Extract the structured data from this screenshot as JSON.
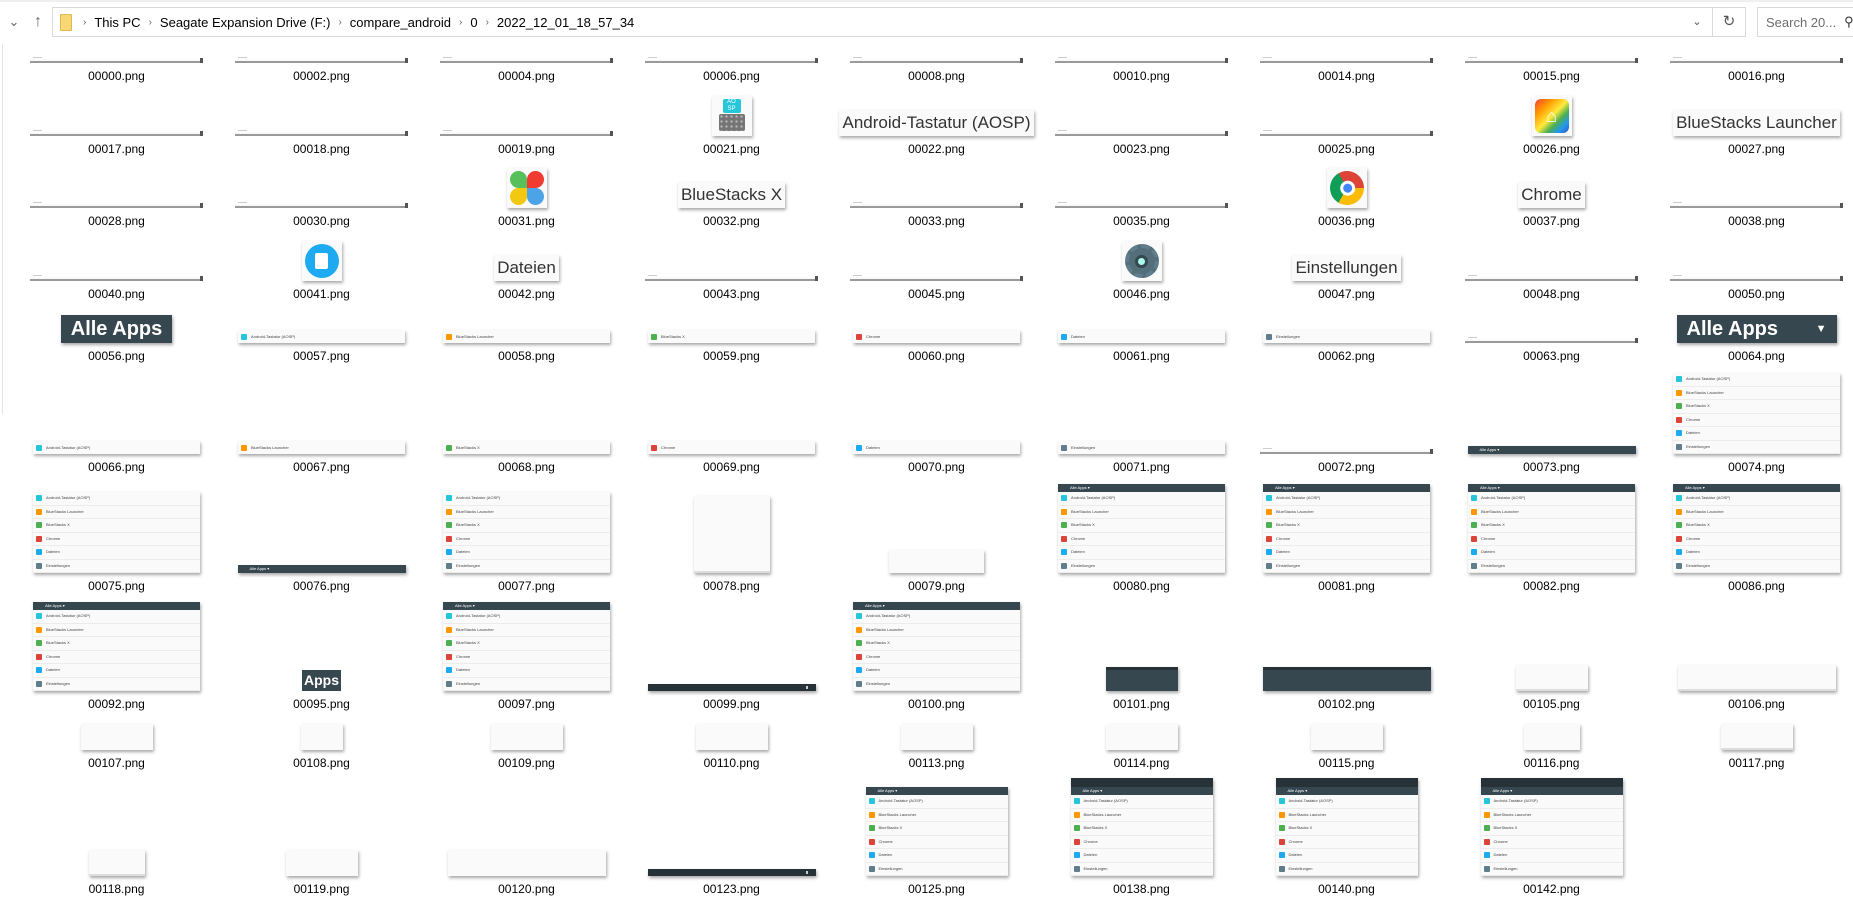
{
  "address_bar": {
    "breadcrumbs": [
      "This PC",
      "Seagate Expansion Drive (F:)",
      "compare_android",
      "0",
      "2022_12_01_18_57_34"
    ],
    "search_placeholder": "Search 20..."
  },
  "icons": {
    "up": "up-arrow-icon",
    "recent": "chevron-down-icon",
    "refresh": "refresh-icon",
    "search": "search-icon",
    "folder": "folder-icon"
  },
  "colors": {
    "header_dark": "#37474f",
    "toolbar_dark": "#263238"
  },
  "app_list": [
    {
      "name": "Android-Tastatur (AOSP)",
      "color": "#26c6da"
    },
    {
      "name": "BlueStacks Launcher",
      "color": "#ff9800"
    },
    {
      "name": "BlueStacks X",
      "color": "#4caf50"
    },
    {
      "name": "Chrome",
      "color": "#db4437"
    },
    {
      "name": "Dateien",
      "color": "#1eaaf1"
    },
    {
      "name": "Einstellungen",
      "color": "#607d8b"
    }
  ],
  "list_header_label": "Alle Apps ▾",
  "rows": [
    [
      {
        "name": "00000.png",
        "t": "bar"
      },
      {
        "name": "00002.png",
        "t": "bar"
      },
      {
        "name": "00004.png",
        "t": "bar"
      },
      {
        "name": "00006.png",
        "t": "bar"
      },
      {
        "name": "00008.png",
        "t": "bar"
      },
      {
        "name": "00010.png",
        "t": "bar"
      },
      {
        "name": "00014.png",
        "t": "bar"
      },
      {
        "name": "00015.png",
        "t": "bar"
      },
      {
        "name": "00016.png",
        "t": "bar"
      }
    ],
    [
      {
        "name": "00017.png",
        "t": "bar"
      },
      {
        "name": "00018.png",
        "t": "bar"
      },
      {
        "name": "00019.png",
        "t": "bar"
      },
      {
        "name": "00021.png",
        "t": "icon",
        "icon": "aosp-keyboard"
      },
      {
        "name": "00022.png",
        "t": "text",
        "text": "Android-Tastatur (AOSP)"
      },
      {
        "name": "00023.png",
        "t": "bar"
      },
      {
        "name": "00025.png",
        "t": "bar"
      },
      {
        "name": "00026.png",
        "t": "icon",
        "icon": "bluestacks-launcher"
      },
      {
        "name": "00027.png",
        "t": "text",
        "text": "BlueStacks Launcher"
      }
    ],
    [
      {
        "name": "00028.png",
        "t": "bar"
      },
      {
        "name": "00030.png",
        "t": "bar"
      },
      {
        "name": "00031.png",
        "t": "icon",
        "icon": "bluestacks-x"
      },
      {
        "name": "00032.png",
        "t": "text",
        "text": "BlueStacks X"
      },
      {
        "name": "00033.png",
        "t": "bar"
      },
      {
        "name": "00035.png",
        "t": "bar"
      },
      {
        "name": "00036.png",
        "t": "icon",
        "icon": "chrome"
      },
      {
        "name": "00037.png",
        "t": "text",
        "text": "Chrome"
      },
      {
        "name": "00038.png",
        "t": "bar"
      }
    ],
    [
      {
        "name": "00040.png",
        "t": "bar"
      },
      {
        "name": "00041.png",
        "t": "icon",
        "icon": "files"
      },
      {
        "name": "00042.png",
        "t": "text",
        "text": "Dateien"
      },
      {
        "name": "00043.png",
        "t": "bar"
      },
      {
        "name": "00045.png",
        "t": "bar"
      },
      {
        "name": "00046.png",
        "t": "icon",
        "icon": "settings"
      },
      {
        "name": "00047.png",
        "t": "text",
        "text": "Einstellungen"
      },
      {
        "name": "00048.png",
        "t": "bar"
      },
      {
        "name": "00050.png",
        "t": "bar"
      }
    ],
    [
      {
        "name": "00056.png",
        "t": "dark",
        "text": "Alle Apps"
      },
      {
        "name": "00057.png",
        "t": "row",
        "app": 0
      },
      {
        "name": "00058.png",
        "t": "row",
        "app": 1
      },
      {
        "name": "00059.png",
        "t": "row",
        "app": 2
      },
      {
        "name": "00060.png",
        "t": "row",
        "app": 3
      },
      {
        "name": "00061.png",
        "t": "row",
        "app": 4
      },
      {
        "name": "00062.png",
        "t": "row",
        "app": 5
      },
      {
        "name": "00063.png",
        "t": "bar"
      },
      {
        "name": "00064.png",
        "t": "dark-dropdown",
        "text": "Alle Apps",
        "arrow": "▼"
      }
    ],
    [
      {
        "name": "00066.png",
        "t": "row",
        "app": 0
      },
      {
        "name": "00067.png",
        "t": "row",
        "app": 1
      },
      {
        "name": "00068.png",
        "t": "row",
        "app": 2
      },
      {
        "name": "00069.png",
        "t": "row",
        "app": 3
      },
      {
        "name": "00070.png",
        "t": "row",
        "app": 4
      },
      {
        "name": "00071.png",
        "t": "row",
        "app": 5
      },
      {
        "name": "00072.png",
        "t": "bar"
      },
      {
        "name": "00073.png",
        "t": "hbar"
      },
      {
        "name": "00074.png",
        "t": "list"
      }
    ],
    [
      {
        "name": "00075.png",
        "t": "list"
      },
      {
        "name": "00076.png",
        "t": "hbar"
      },
      {
        "name": "00077.png",
        "t": "list"
      },
      {
        "name": "00078.png",
        "t": "card",
        "v": "tall",
        "line": true
      },
      {
        "name": "00079.png",
        "t": "card",
        "v": "short"
      },
      {
        "name": "00080.png",
        "t": "list-header"
      },
      {
        "name": "00081.png",
        "t": "list-header"
      },
      {
        "name": "00082.png",
        "t": "list-header"
      },
      {
        "name": "00086.png",
        "t": "list-header"
      }
    ],
    [
      {
        "name": "00092.png",
        "t": "list-header"
      },
      {
        "name": "00095.png",
        "t": "dark-small",
        "text": "Apps"
      },
      {
        "name": "00097.png",
        "t": "list-header"
      },
      {
        "name": "00099.png",
        "t": "tool"
      },
      {
        "name": "00100.png",
        "t": "list-header"
      },
      {
        "name": "00101.png",
        "t": "block",
        "v": "sq"
      },
      {
        "name": "00102.png",
        "t": "block",
        "v": "wide"
      },
      {
        "name": "00105.png",
        "t": "card",
        "v": "sq",
        "line": true
      },
      {
        "name": "00106.png",
        "t": "card",
        "v": "wide",
        "line": true
      }
    ],
    [
      {
        "name": "00107.png",
        "t": "card",
        "v": "sq"
      },
      {
        "name": "00108.png",
        "t": "card",
        "v": "narrow"
      },
      {
        "name": "00109.png",
        "t": "card",
        "v": "sq"
      },
      {
        "name": "00110.png",
        "t": "card",
        "v": "sq"
      },
      {
        "name": "00113.png",
        "t": "card",
        "v": "sq"
      },
      {
        "name": "00114.png",
        "t": "card",
        "v": "sq"
      },
      {
        "name": "00115.png",
        "t": "card",
        "v": "sq"
      },
      {
        "name": "00116.png",
        "t": "card",
        "v": "mid"
      },
      {
        "name": "00117.png",
        "t": "card",
        "v": "sq",
        "line": true
      }
    ],
    [
      {
        "name": "00118.png",
        "t": "card",
        "v": "mid",
        "line": true
      },
      {
        "name": "00119.png",
        "t": "card",
        "v": "sq"
      },
      {
        "name": "00120.png",
        "t": "card",
        "v": "wide"
      },
      {
        "name": "00123.png",
        "t": "tool"
      },
      {
        "name": "00125.png",
        "t": "list-header",
        "v": "mid"
      },
      {
        "name": "00138.png",
        "t": "list-double"
      },
      {
        "name": "00140.png",
        "t": "list-double"
      },
      {
        "name": "00142.png",
        "t": "list-double"
      }
    ]
  ]
}
